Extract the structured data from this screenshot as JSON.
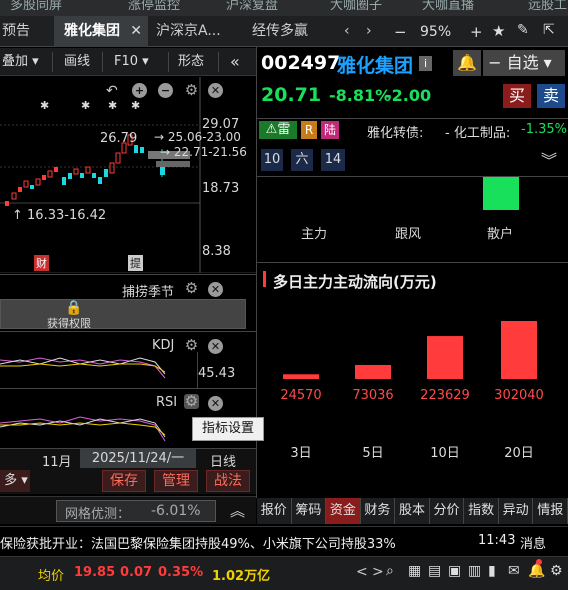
{
  "top_strip": [
    "多股同屏",
    "涨停监控",
    "沪深复盘",
    "大咖圈子",
    "大咖直播",
    "远股工"
  ],
  "tabs": [
    {
      "label": "预告",
      "active": false
    },
    {
      "label": "雅化集团",
      "active": true,
      "close": "✕"
    },
    {
      "label": "沪深京A...",
      "active": false
    },
    {
      "label": "经传多赢",
      "active": false
    }
  ],
  "window_controls": {
    "zoom": "95%"
  },
  "chart_toolbar": {
    "overlay": "叠加",
    "draw_line": "画线",
    "f10": "F10",
    "shape": "形态"
  },
  "kline": {
    "y_labels": [
      "29.07",
      "18.73",
      "8.38"
    ],
    "annotation_high": "26.79",
    "annotation_range1": "25.06-23.00",
    "annotation_range2": "22.71-21.56",
    "annotation_low": "16.33-16.42",
    "marker_cai": "财",
    "marker_ti": "提"
  },
  "season_panel": {
    "title": "捕捞季节",
    "button": "获得权限"
  },
  "kdj_panel": {
    "title": "KDJ",
    "value": "45.43"
  },
  "rsi_panel": {
    "title": "RSI",
    "tooltip": "指标设置"
  },
  "date_bar": {
    "month": "11月",
    "date": "2025/11/24/一",
    "period": "日线"
  },
  "action_bar": {
    "more": "多",
    "buy": "保存",
    "manage": "管理",
    "battle": "战法"
  },
  "stock": {
    "code": "002497",
    "name": "雅化集团",
    "price": "20.71",
    "change_pct": "-8.81%",
    "change": "-2.00",
    "watchlist": "自选",
    "buy": "买",
    "sell": "卖",
    "tags": [
      "雷",
      "R",
      "陆"
    ],
    "concept": "雅化转债:",
    "industry": "- 化工制品:",
    "industry_pct": "-1.35%",
    "period_btns": [
      "10",
      "六",
      "14"
    ]
  },
  "flow_top": {
    "labels": [
      "主力",
      "跟风",
      "散户"
    ]
  },
  "flow_chart": {
    "title": "多日主力主动流向(万元)",
    "categories": [
      "3日",
      "5日",
      "10日",
      "20日"
    ],
    "values": [
      24570,
      73036,
      223629,
      302040
    ],
    "value_labels": [
      "24570",
      "73036",
      "223629",
      "302040"
    ]
  },
  "right_tabs": [
    "报价",
    "筹码",
    "资金",
    "财务",
    "股本",
    "分价",
    "指数",
    "异动",
    "情报"
  ],
  "grid_bar": {
    "label": "网格优测：",
    "value": "-6.01%"
  },
  "news": {
    "text": "保险获批开业：法国巴黎保险集团持股49%、小米旗下公司持股33%",
    "time": "11:43",
    "more": "消息"
  },
  "status": {
    "avg_label": "均价",
    "avg": "19.85",
    "chg": "0.07",
    "pct": "0.35%",
    "amount": "1.02万亿"
  },
  "colors": {
    "up": "#ff3b3b",
    "down": "#19e05a",
    "bg": "#000000",
    "accent_blue": "#1da1ff"
  }
}
